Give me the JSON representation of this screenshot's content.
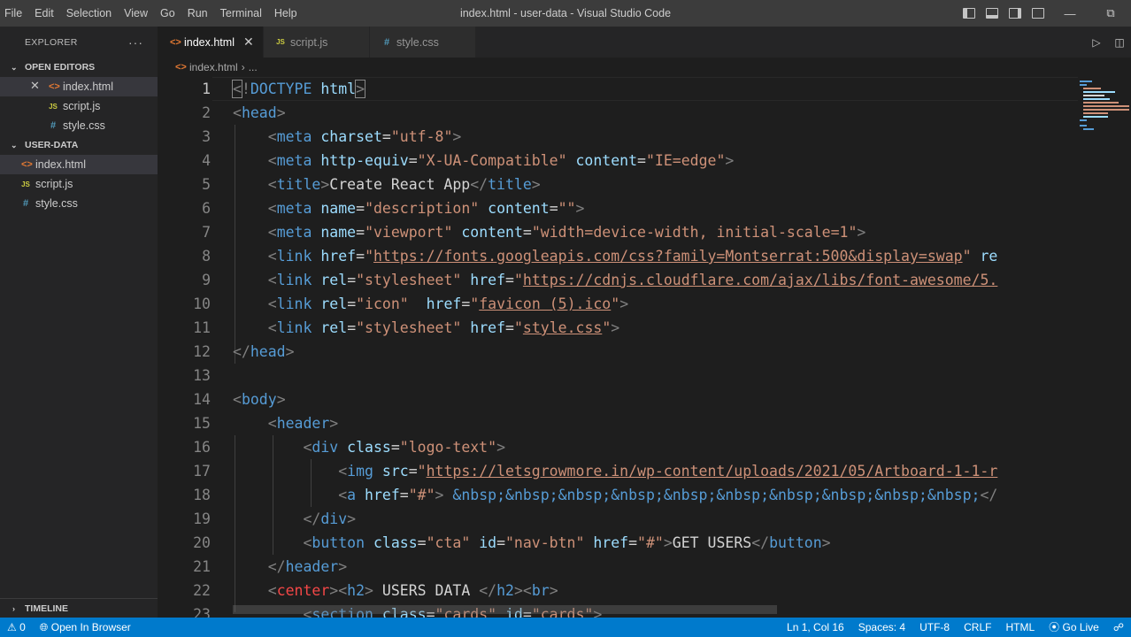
{
  "titlebar": {
    "menu": [
      "File",
      "Edit",
      "Selection",
      "View",
      "Go",
      "Run",
      "Terminal",
      "Help"
    ],
    "title": "index.html - user-data - Visual Studio Code"
  },
  "sidebar": {
    "header": "EXPLORER",
    "open_editors_label": "OPEN EDITORS",
    "open_editors": [
      {
        "name": "index.html",
        "icon": "html-file-icon"
      },
      {
        "name": "script.js",
        "icon": "js-file-icon"
      },
      {
        "name": "style.css",
        "icon": "css-file-icon"
      }
    ],
    "folder_label": "USER-DATA",
    "files": [
      {
        "name": "index.html",
        "icon": "html-file-icon"
      },
      {
        "name": "script.js",
        "icon": "js-file-icon"
      },
      {
        "name": "style.css",
        "icon": "css-file-icon"
      }
    ],
    "timeline_label": "TIMELINE"
  },
  "tabs": [
    {
      "label": "index.html",
      "active": true
    },
    {
      "label": "script.js",
      "active": false
    },
    {
      "label": "style.css",
      "active": false
    }
  ],
  "breadcrumb": {
    "file": "index.html",
    "more": "..."
  },
  "editor": {
    "current_line": 1,
    "line_numbers": [
      "1",
      "2",
      "3",
      "4",
      "5",
      "6",
      "7",
      "8",
      "9",
      "10",
      "11",
      "12",
      "13",
      "14",
      "15",
      "16",
      "17",
      "18",
      "19",
      "20",
      "21",
      "22",
      "23"
    ]
  },
  "statusbar": {
    "problems": "0",
    "open_in_browser": "Open In Browser",
    "position": "Ln 1, Col 16",
    "spaces": "Spaces: 4",
    "encoding": "UTF-8",
    "eol": "CRLF",
    "language": "HTML",
    "go_live": "Go Live"
  },
  "colors": {
    "accent": "#007acc",
    "tag": "#569cd6",
    "attribute": "#9cdcfe",
    "string": "#ce9178"
  }
}
